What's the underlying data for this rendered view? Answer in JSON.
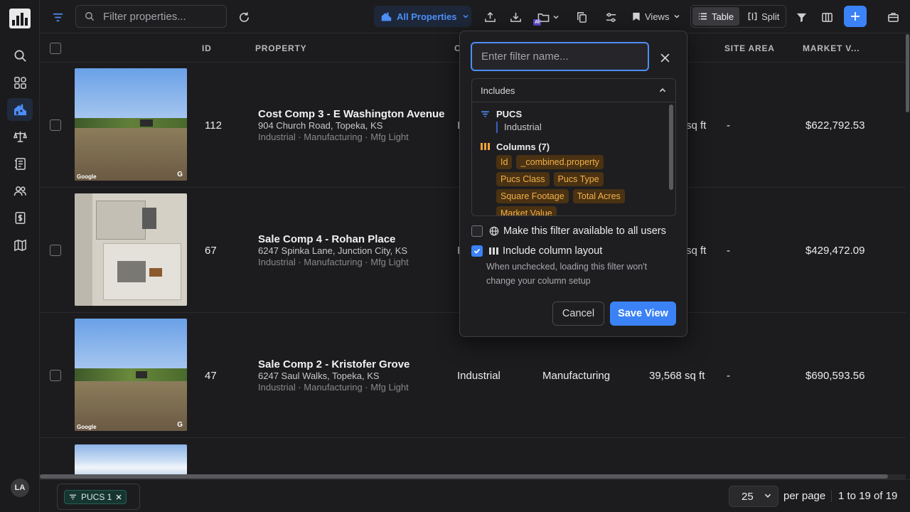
{
  "toolbar": {
    "search_placeholder": "Filter properties...",
    "scope_label": "All Properties",
    "ai_badge": "AI",
    "views_label": "Views",
    "table_label": "Table",
    "split_label": "Split"
  },
  "table": {
    "headers": {
      "id": "ID",
      "property": "PROPERTY",
      "c": "C",
      "site_area": "SITE AREA",
      "market_value": "MARKET V..."
    },
    "rows": [
      {
        "id": "112",
        "name": "Cost Comp 3 - E Washington Avenue",
        "address": "904 Church Road, Topeka, KS",
        "tags": "Industrial · Manufacturing · Mfg Light",
        "pucs_class": "I",
        "pucs_type": "",
        "sqft": "sq ft",
        "site_area": "-",
        "market_value": "$622,792.53",
        "photo": "street",
        "photo_credit": "Google"
      },
      {
        "id": "67",
        "name": "Sale Comp 4 - Rohan Place",
        "address": "6247 Spinka Lane, Junction City, KS",
        "tags": "Industrial · Manufacturing · Mfg Light",
        "pucs_class": "I",
        "pucs_type": "",
        "sqft": "sq ft",
        "site_area": "-",
        "market_value": "$429,472.09",
        "photo": "aerial",
        "photo_credit": ""
      },
      {
        "id": "47",
        "name": "Sale Comp 2 - Kristofer Grove",
        "address": "6247 Saul Walks, Topeka, KS",
        "tags": "Industrial · Manufacturing · Mfg Light",
        "pucs_class": "Industrial",
        "pucs_type": "Manufacturing",
        "sqft": "39,568 sq ft",
        "site_area": "-",
        "market_value": "$690,593.56",
        "photo": "street",
        "photo_credit": "Google"
      }
    ]
  },
  "popover": {
    "name_placeholder": "Enter filter name...",
    "includes_label": "Includes",
    "pucs_title": "PUCS",
    "pucs_value": "Industrial",
    "columns_title": "Columns (7)",
    "columns": [
      "Id",
      "_combined.property",
      "Pucs Class",
      "Pucs Type",
      "Square Footage",
      "Total Acres",
      "Market Value"
    ],
    "share_label": "Make this filter available to all users",
    "share_checked": false,
    "layout_label": "Include column layout",
    "layout_checked": true,
    "layout_hint": "When unchecked, loading this filter won't change your column setup",
    "cancel_label": "Cancel",
    "save_label": "Save View"
  },
  "footer": {
    "chip_label": "PUCS 1",
    "page_size": "25",
    "per_page_label": "per page",
    "range_label": "1 to 19 of 19"
  },
  "user": {
    "initials": "LA"
  },
  "colors": {
    "accent": "#3b82f6",
    "tag_bg": "#4a3212",
    "tag_text": "#f2b04a",
    "chip_bg": "#173530"
  }
}
